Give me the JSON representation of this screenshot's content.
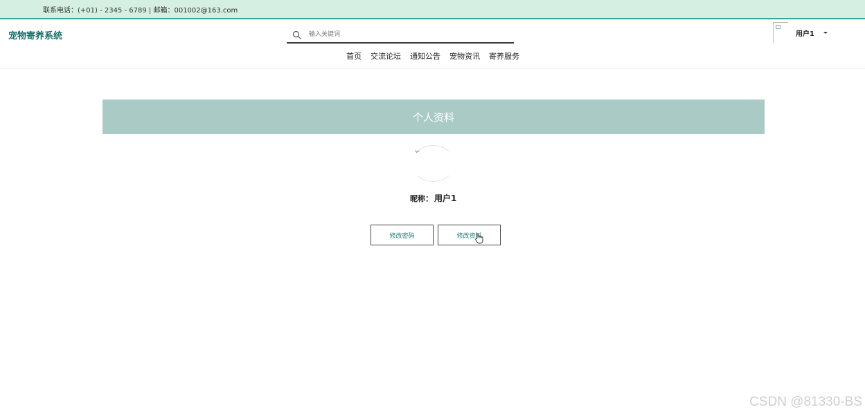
{
  "topbar": {
    "contact_text": "联系电话：(+01) - 2345 - 6789 | 邮箱：001002@163.com"
  },
  "header": {
    "brand": "宠物寄养系统",
    "search": {
      "placeholder": "输入关键词",
      "icon": "search-icon"
    },
    "nav": {
      "items": [
        {
          "label": "首页"
        },
        {
          "label": "交流论坛"
        },
        {
          "label": "通知公告"
        },
        {
          "label": "宠物资讯"
        },
        {
          "label": "寄养服务"
        }
      ]
    },
    "user": {
      "name": "用户1",
      "icon": "chevron-down-icon"
    }
  },
  "profile": {
    "title": "个人资料",
    "nickname_label": "昵称：",
    "nickname_value": "用户1",
    "buttons": {
      "change_password": "修改密码",
      "edit_profile": "修改资料"
    }
  },
  "watermark": "CSDN @81330-BS",
  "colors": {
    "topbar_bg": "#d5efe3",
    "brand": "#1b6f6b",
    "banner_bg": "#aacac5",
    "button_text": "#1e7c79"
  }
}
